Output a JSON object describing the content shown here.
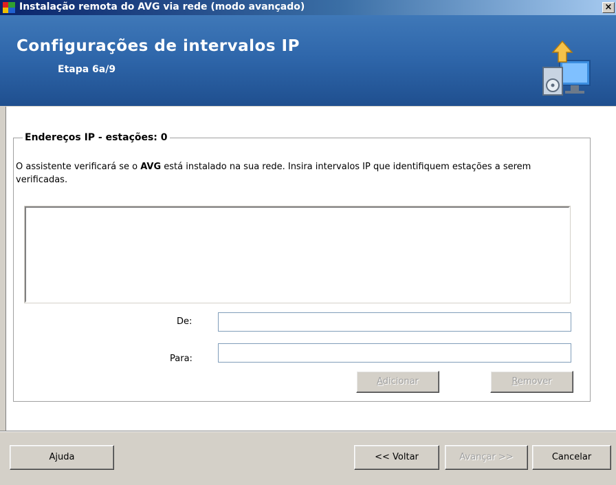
{
  "window": {
    "title": "Instalação remota do AVG via rede (modo avançado)",
    "close_label": "×"
  },
  "header": {
    "title": "Configurações de intervalos IP",
    "step": "Etapa 6a/9"
  },
  "group": {
    "legend": "Endereços IP - estações: 0",
    "desc_before": "O assistente verificará se o ",
    "desc_bold": "AVG",
    "desc_after": " está instalado na sua rede. Insira intervalos IP que identifiquem estações a serem verificadas.",
    "from_label": "De:",
    "from_value": "",
    "to_label": "Para:",
    "to_value": "",
    "add_first": "A",
    "add_rest": "dicionar",
    "remove_first": "R",
    "remove_rest": "emover"
  },
  "footer": {
    "help": "Ajuda",
    "back": "<< Voltar",
    "next": "Avançar >>",
    "cancel": "Cancelar"
  }
}
